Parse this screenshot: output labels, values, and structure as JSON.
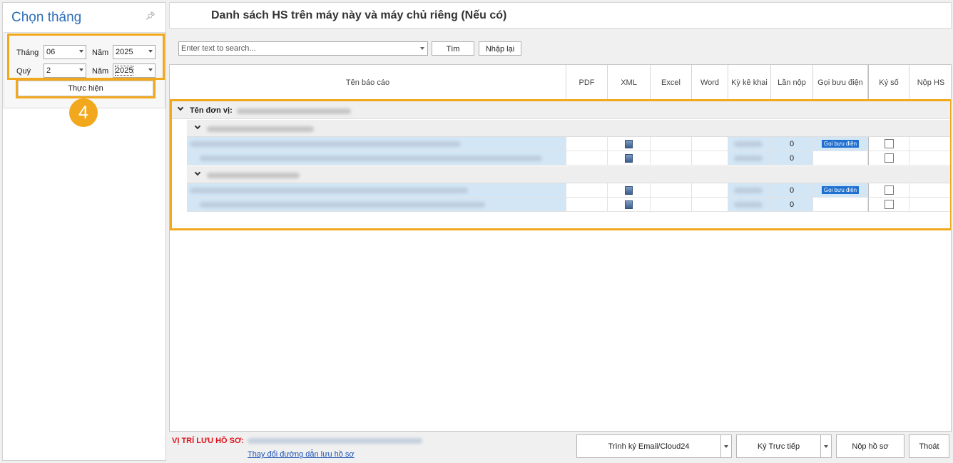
{
  "left": {
    "title": "Chọn tháng",
    "pin_icon": "pin-icon",
    "month_label": "Tháng",
    "month_value": "06",
    "year_label": "Năm",
    "year_value_1": "2025",
    "quarter_label": "Quý",
    "quarter_value": "2",
    "year_value_2": "2025",
    "execute_label": "Thực hiện",
    "step_number": "4"
  },
  "header": {
    "title": "Danh sách HS trên máy này và máy chủ riêng (Nếu có)"
  },
  "toolbar": {
    "search_placeholder": "Enter text to search...",
    "find_label": "Tìm",
    "reset_label": "Nhập lại"
  },
  "grid": {
    "columns": [
      "Tên báo cáo",
      "PDF",
      "XML",
      "Excel",
      "Word",
      "Kỳ kê khai",
      "Lần nộp",
      "Gọi bưu điện",
      "Ký số",
      "Nộp HS"
    ],
    "unit_label": "Tên đơn vị:",
    "groups": [
      {
        "rows": [
          {
            "submit_count": "0",
            "call_label": "Gọi bưu điện"
          },
          {
            "submit_count": "0",
            "call_label": ""
          }
        ]
      },
      {
        "rows": [
          {
            "submit_count": "0",
            "call_label": "Gọi bưu điện"
          },
          {
            "submit_count": "0",
            "call_label": ""
          }
        ]
      }
    ]
  },
  "bottom": {
    "location_label": "VỊ TRÍ LƯU HỒ SƠ:",
    "change_path_link": "Thay đổi đường dẫn lưu hồ sơ",
    "sign_email_label": "Trình ký Email/Cloud24",
    "sign_direct_label": "Ký Trực tiếp",
    "submit_label": "Nộp hồ sơ",
    "exit_label": "Thoát"
  },
  "colors": {
    "accent": "#2e6fb8",
    "highlight": "#f2a81d",
    "selected_row": "#d2e6f6",
    "warning_text": "#e0121b"
  }
}
